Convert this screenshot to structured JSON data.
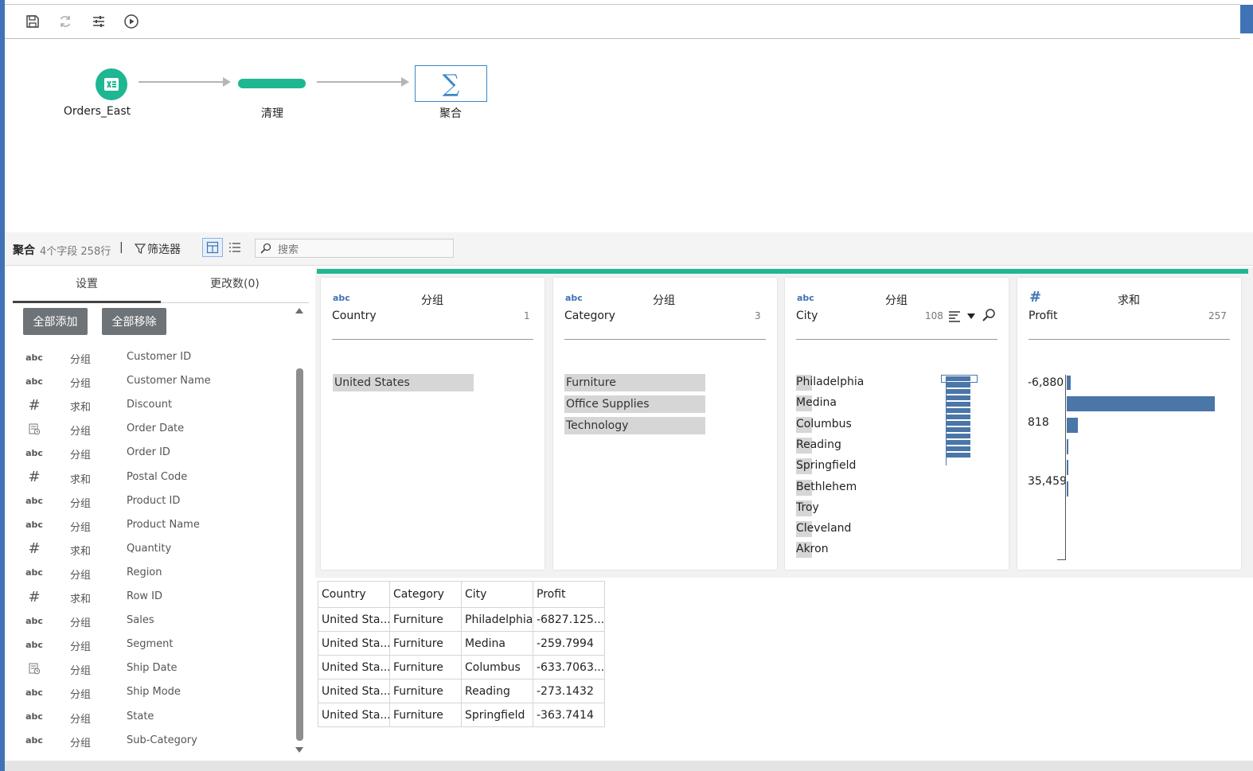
{
  "flow": {
    "nodes": [
      {
        "label": "Orders_East"
      },
      {
        "label": "清理"
      },
      {
        "label": "聚合",
        "symbol": "∑"
      }
    ]
  },
  "infobar": {
    "title": "聚合",
    "meta": "4个字段 258行",
    "separator": "|",
    "filter_label": "筛选器",
    "search_placeholder": "搜索"
  },
  "leftpanel": {
    "tabs": [
      {
        "label": "设置"
      },
      {
        "label": "更改数(0)"
      }
    ],
    "add_all_label": "全部添加",
    "remove_all_label": "全部移除",
    "fields": [
      {
        "type": "abc",
        "agg": "分组",
        "name": "Customer ID"
      },
      {
        "type": "abc",
        "agg": "分组",
        "name": "Customer Name"
      },
      {
        "type": "#",
        "agg": "求和",
        "name": "Discount"
      },
      {
        "type": "date-icon",
        "agg": "分组",
        "name": "Order Date"
      },
      {
        "type": "abc",
        "agg": "分组",
        "name": "Order ID"
      },
      {
        "type": "#",
        "agg": "求和",
        "name": "Postal Code"
      },
      {
        "type": "abc",
        "agg": "分组",
        "name": "Product ID"
      },
      {
        "type": "abc",
        "agg": "分组",
        "name": "Product Name"
      },
      {
        "type": "#",
        "agg": "求和",
        "name": "Quantity"
      },
      {
        "type": "abc",
        "agg": "分组",
        "name": "Region"
      },
      {
        "type": "#",
        "agg": "求和",
        "name": "Row ID"
      },
      {
        "type": "abc",
        "agg": "分组",
        "name": "Sales"
      },
      {
        "type": "abc",
        "agg": "分组",
        "name": "Segment"
      },
      {
        "type": "date-icon",
        "agg": "分组",
        "name": "Ship Date"
      },
      {
        "type": "abc",
        "agg": "分组",
        "name": "Ship Mode"
      },
      {
        "type": "abc",
        "agg": "分组",
        "name": "State"
      },
      {
        "type": "abc",
        "agg": "分组",
        "name": "Sub-Category"
      }
    ]
  },
  "cards": [
    {
      "type": "abc",
      "agg": "分组",
      "name": "Country",
      "count": "1",
      "values": [
        "United States"
      ]
    },
    {
      "type": "abc",
      "agg": "分组",
      "name": "Category",
      "count": "3",
      "values": [
        "Furniture",
        "Office Supplies",
        "Technology"
      ]
    },
    {
      "type": "abc",
      "agg": "分组",
      "name": "City",
      "count": "108",
      "values": [
        "Philadelphia",
        "Medina",
        "Columbus",
        "Reading",
        "Springfield",
        "Bethlehem",
        "Troy",
        "Cleveland",
        "Akron"
      ]
    },
    {
      "type": "#",
      "agg": "求和",
      "name": "Profit",
      "count": "257",
      "labels": [
        "-6,880",
        "818",
        "35,459"
      ]
    }
  ],
  "table": {
    "columns": [
      "Country",
      "Category",
      "City",
      "Profit"
    ],
    "rows": [
      [
        "United Sta...",
        "Furniture",
        "Philadelphia",
        "-6827.125..."
      ],
      [
        "United Sta...",
        "Furniture",
        "Medina",
        "-259.7994"
      ],
      [
        "United Sta...",
        "Furniture",
        "Columbus",
        "-633.7063..."
      ],
      [
        "United Sta...",
        "Furniture",
        "Reading",
        "-273.1432"
      ],
      [
        "United Sta...",
        "Furniture",
        "Springfield",
        "-363.7414"
      ]
    ]
  },
  "colors": {
    "accent": "#1fb692",
    "brand": "#3f73b5",
    "bar": "#4a76a8"
  }
}
